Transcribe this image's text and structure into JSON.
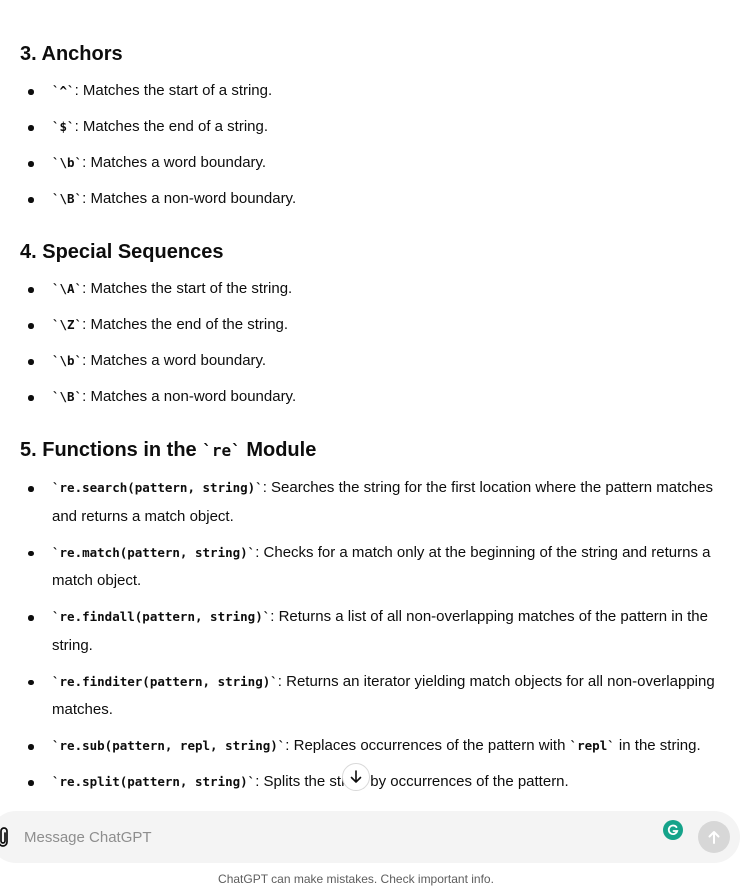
{
  "sections": [
    {
      "number": "3.",
      "title": "Anchors",
      "items": [
        {
          "code": "`^`",
          "text": ": Matches the start of a string."
        },
        {
          "code": "`$`",
          "text": ": Matches the end of a string."
        },
        {
          "code": "`\\b`",
          "text": ": Matches a word boundary."
        },
        {
          "code": "`\\B`",
          "text": ": Matches a non-word boundary."
        }
      ]
    },
    {
      "number": "4.",
      "title": "Special Sequences",
      "items": [
        {
          "code": "`\\A`",
          "text": ": Matches the start of the string."
        },
        {
          "code": "`\\Z`",
          "text": ": Matches the end of the string."
        },
        {
          "code": "`\\b`",
          "text": ": Matches a word boundary."
        },
        {
          "code": "`\\B`",
          "text": ": Matches a non-word boundary."
        }
      ]
    },
    {
      "number": "5.",
      "title_before": "Functions in the ",
      "title_code": "`re`",
      "title_after": " Module",
      "items": [
        {
          "code": "`re.search(pattern, string)`",
          "text": ": Searches the string for the first location where the pattern matches and returns a match object."
        },
        {
          "code": "`re.match(pattern, string)`",
          "text": ": Checks for a match only at the beginning of the string and returns a match object."
        },
        {
          "code": "`re.findall(pattern, string)`",
          "text": ": Returns a list of all non-overlapping matches of the pattern in the string."
        },
        {
          "code": "`re.finditer(pattern, string)`",
          "text": ": Returns an iterator yielding match objects for all non-overlapping matches."
        },
        {
          "code": "`re.sub(pattern, repl, string)`",
          "text": ": Replaces occurrences of the pattern with ",
          "code2": "`repl`",
          "text2": " in the string."
        },
        {
          "code": "`re.split(pattern, string)`",
          "text": ": Splits the string by occurrences of the pattern."
        }
      ]
    }
  ],
  "composer": {
    "placeholder": "Message ChatGPT",
    "value": ""
  },
  "disclaimer": "ChatGPT can make mistakes. Check important info.",
  "icons": {
    "attach": "paperclip-icon",
    "grammarly": "grammarly-icon",
    "send": "arrow-up-icon",
    "scroll": "arrow-down-icon"
  },
  "colors": {
    "text": "#0d0d0d",
    "composer_bg": "#f4f4f4",
    "placeholder": "#8e8e8e",
    "send_disabled": "#d7d7d7",
    "grammarly": "#15a38a"
  }
}
